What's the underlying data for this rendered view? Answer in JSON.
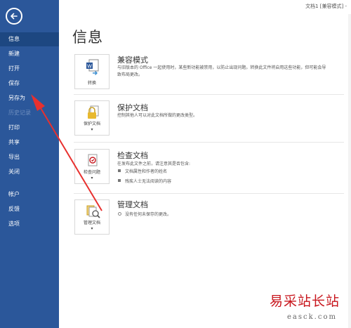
{
  "window": {
    "title": "文档1 [兼容模式] -"
  },
  "sidebar": {
    "items": [
      {
        "label": "信息",
        "state": "active"
      },
      {
        "label": "新建",
        "state": "normal"
      },
      {
        "label": "打开",
        "state": "normal"
      },
      {
        "label": "保存",
        "state": "normal"
      },
      {
        "label": "另存为",
        "state": "normal"
      },
      {
        "label": "历史记录",
        "state": "disabled"
      },
      {
        "label": "打印",
        "state": "normal"
      },
      {
        "label": "共享",
        "state": "normal"
      },
      {
        "label": "导出",
        "state": "normal"
      },
      {
        "label": "关闭",
        "state": "normal"
      },
      {
        "label": "帐户",
        "state": "normal"
      },
      {
        "label": "反馈",
        "state": "normal"
      },
      {
        "label": "选项",
        "state": "normal"
      }
    ]
  },
  "main": {
    "heading": "信息",
    "sections": [
      {
        "button_label": "转换",
        "title": "兼容模式",
        "description": "与旧版本的 Office 一起使用时，某些新功能被禁用，以防止出现问题。转换此文件将启用这些功能，但可能会导致布局更改。"
      },
      {
        "button_label": "保护文档",
        "title": "保护文档",
        "description": "控制其他人可以对此文档所做的更改类型。"
      },
      {
        "button_label": "检查问题",
        "title": "检查文档",
        "description": "在发布此文件之前，请注意其是否包含:",
        "bullets": [
          "文档属性和作者的姓名",
          "残疾人士无法阅读的内容"
        ]
      },
      {
        "button_label": "管理文档",
        "title": "管理文档",
        "description": "",
        "bullets": [
          "没有任何未保存的更改。"
        ]
      }
    ]
  },
  "watermark": {
    "text": "易采站长站",
    "url": "easck.com"
  },
  "colors": {
    "sidebar": "#2b579a",
    "sidebar_active": "#1d4781",
    "annotation_arrow": "#e8302e",
    "watermark": "#c8161d"
  }
}
